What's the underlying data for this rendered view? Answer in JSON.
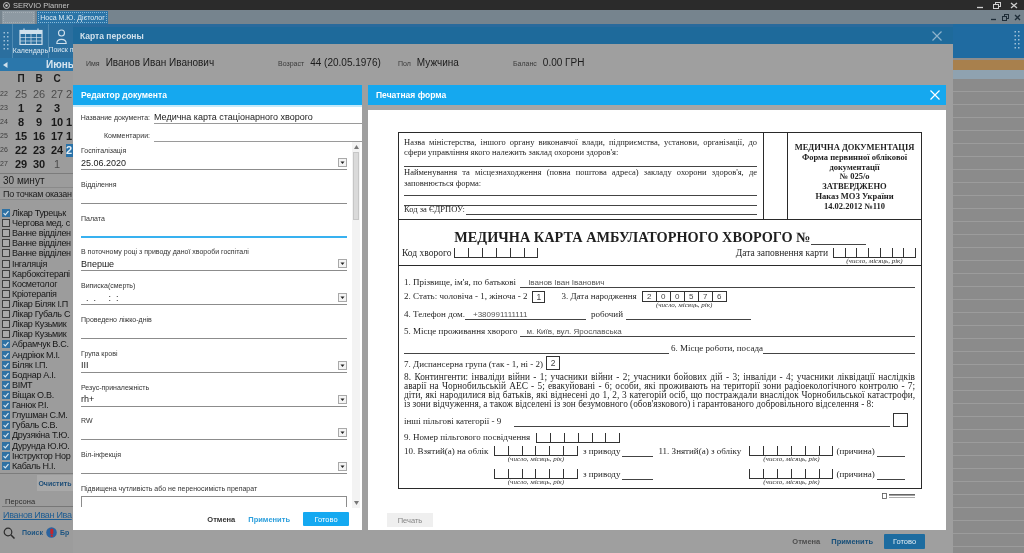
{
  "app": {
    "title": "SERVIO Planner",
    "tabs": [
      {
        "selected": false
      },
      {
        "label": "Носа М.Ю. Дієтолог",
        "selected": true
      }
    ],
    "toolbar": [
      {
        "kind": "calendar",
        "label": "Календарь"
      },
      {
        "kind": "person",
        "label": "Поиск п"
      }
    ]
  },
  "calendar": {
    "month": "Июнь",
    "weekdays": [
      "П",
      "В",
      "С"
    ],
    "weeks": [
      {
        "number": "22",
        "days": [
          {
            "day": "25",
            "other_month": true,
            "selected": false
          },
          {
            "day": "26",
            "other_month": true,
            "selected": false
          },
          {
            "day": "27",
            "other_month": true,
            "selected": false
          },
          {
            "day": "2",
            "other_month": true,
            "selected": false
          }
        ]
      },
      {
        "number": "23",
        "days": [
          {
            "day": "1",
            "other_month": false,
            "selected": false
          },
          {
            "day": "2",
            "other_month": false,
            "selected": false
          },
          {
            "day": "3",
            "other_month": false,
            "selected": false
          }
        ]
      },
      {
        "number": "24",
        "days": [
          {
            "day": "8",
            "other_month": false,
            "selected": false
          },
          {
            "day": "9",
            "other_month": false,
            "selected": false
          },
          {
            "day": "10",
            "other_month": false,
            "selected": false
          },
          {
            "day": "1",
            "other_month": false,
            "selected": false
          }
        ]
      },
      {
        "number": "25",
        "days": [
          {
            "day": "15",
            "other_month": false,
            "selected": false
          },
          {
            "day": "16",
            "other_month": false,
            "selected": false
          },
          {
            "day": "17",
            "other_month": false,
            "selected": false
          },
          {
            "day": "1",
            "other_month": false,
            "selected": false
          }
        ]
      },
      {
        "number": "26",
        "days": [
          {
            "day": "22",
            "other_month": false,
            "selected": false
          },
          {
            "day": "23",
            "other_month": false,
            "selected": false
          },
          {
            "day": "24",
            "other_month": false,
            "selected": false
          },
          {
            "day": "2",
            "other_month": false,
            "selected": true
          }
        ]
      },
      {
        "number": "27",
        "days": [
          {
            "day": "29",
            "other_month": false,
            "selected": false
          },
          {
            "day": "30",
            "other_month": false,
            "selected": false
          },
          {
            "day": "1",
            "other_month": true,
            "selected": false
          }
        ]
      }
    ]
  },
  "interval": "30 минут",
  "filter": "По точкам оказан",
  "resources": [
    {
      "label": "Лікар Турецьк",
      "checked": true
    },
    {
      "label": "Чергова мед. с",
      "checked": false
    },
    {
      "label": "Ванне відділен",
      "checked": false
    },
    {
      "label": "Ванне відділен",
      "checked": false
    },
    {
      "label": "Ванне відділен",
      "checked": false
    },
    {
      "label": "Інгаляція",
      "checked": false
    },
    {
      "label": "Карбоксітерапі",
      "checked": false
    },
    {
      "label": "Косметолог",
      "checked": false
    },
    {
      "label": "Кріотерапія",
      "checked": false
    },
    {
      "label": "Лікар Біляк І.П",
      "checked": false
    },
    {
      "label": "Лікар Губаль С",
      "checked": false
    },
    {
      "label": "Лікар Кузьмик",
      "checked": false
    },
    {
      "label": "Лікар Кузьмик",
      "checked": false
    },
    {
      "label": "Абрамчук В.С.",
      "checked": true
    },
    {
      "label": "Андріюк М.І.",
      "checked": true
    },
    {
      "label": "Біляк І.П.",
      "checked": true
    },
    {
      "label": "Боднар А.І.",
      "checked": true
    },
    {
      "label": "ВІМТ",
      "checked": true
    },
    {
      "label": "Віщак О.В.",
      "checked": true
    },
    {
      "label": "Ганюк Р.І.",
      "checked": true
    },
    {
      "label": "Глушман С.М.",
      "checked": true
    },
    {
      "label": "Губаль С.В.",
      "checked": true
    },
    {
      "label": "Друзякіна Т.Ю.",
      "checked": true
    },
    {
      "label": "Дурунда Ю.Ю.",
      "checked": true
    },
    {
      "label": "Інструктор Нор",
      "checked": true
    },
    {
      "label": "Кабаль Н.І.",
      "checked": true
    }
  ],
  "clear_button": "Очистить",
  "person_section": {
    "label": "Персона",
    "link": "Иванов Иван Ива"
  },
  "bottom_actions": [
    {
      "kind": "search",
      "label": "Поиск"
    },
    {
      "kind": "alert",
      "label": "Бр"
    }
  ],
  "person_card": {
    "title": "Карта персоны",
    "fields": [
      {
        "label": "Имя",
        "value": "Иванов Иван Иванович"
      },
      {
        "label": "Возраст",
        "value": "44 (20.05.1976)"
      },
      {
        "label": "Пол",
        "value": "Мужчина"
      },
      {
        "label": "Баланс",
        "value": "0.00 ГРН"
      }
    ],
    "buttons": [
      {
        "kind": "cancel",
        "label": "Отмена",
        "disabled": true
      },
      {
        "kind": "apply",
        "label": "Применить",
        "disabled": false
      },
      {
        "kind": "done",
        "label": "Готово",
        "disabled": false
      }
    ]
  },
  "editor": {
    "title": "Редактор документа",
    "name_label": "Название документа:",
    "name_value": "Медична карта стаціонарного хворого",
    "comment_label": "Комментарии:",
    "fields": [
      {
        "kind": "dropdown",
        "label": "Госпіталізація",
        "value": "25.06.2020",
        "focused": false
      },
      {
        "kind": "text",
        "label": "Відділення",
        "focused": false
      },
      {
        "kind": "text",
        "label": "Палата",
        "focused": true
      },
      {
        "kind": "dropdown",
        "label": "В поточному році з приводу даної хвороби госпіталі",
        "value": "Вперше",
        "focused": false
      },
      {
        "kind": "dropdown",
        "label": "Виписка(смерть)",
        "value": "  .  .     :  :",
        "focused": false
      },
      {
        "kind": "text",
        "label": "Проведено ліжко-днів",
        "focused": false
      },
      {
        "kind": "dropdown",
        "label": "Група крові",
        "value": "III",
        "focused": false
      },
      {
        "kind": "dropdown",
        "label": "Резус-приналежність",
        "value": "rh+",
        "focused": false
      },
      {
        "kind": "dropdown",
        "label": "RW",
        "focused": false
      },
      {
        "kind": "dropdown",
        "label": "Віл-інфекція",
        "focused": false
      },
      {
        "kind": "textarea",
        "label": "Підвищена чутливість або не переносимість препарат",
        "focused": false
      }
    ],
    "buttons": [
      {
        "kind": "cancel",
        "label": "Отмена"
      },
      {
        "kind": "apply",
        "label": "Применить"
      },
      {
        "kind": "done",
        "label": "Готово"
      }
    ]
  },
  "print_form": {
    "title": "Печатная форма",
    "print_button": {
      "label": "Печать",
      "disabled": true
    },
    "document": {
      "ministry_text": "Назва міністерства, іншого органу виконавчої влади, підприємства, установи, організації, до сфери управління якого належить заклад охорони здоров'я:",
      "institution_text": "Найменування та місцезнаходження (повна поштова адреса) закладу охорони здоров'я, де заповнюється форма:",
      "edrpou_label": "Код за ЄДРПОУ:",
      "stamp": [
        "МЕДИЧНА ДОКУМЕНТАЦІЯ",
        "Форма первинної облікової",
        "документації",
        "№ 025/о",
        "ЗАТВЕРДЖЕНО",
        "Наказ МОЗ України",
        "14.02.2012 №110"
      ],
      "title": "МЕДИЧНА КАРТА АМБУЛАТОРНОГО ХВОРОГО №",
      "patient_code_label": "Код хворого",
      "fill_date": {
        "label": "Дата заповнення карти",
        "hint": "(число, місяць, рік)"
      },
      "full_name": {
        "label": "1. Прізвище, ім'я, по батькові",
        "value": "Іванов Іван Іванович"
      },
      "sex": {
        "label": "2. Стать: чоловіча - 1, жіноча - 2",
        "value": "1"
      },
      "birth_date": {
        "label": "3. Дата народження",
        "digits": [
          "2",
          "0",
          "0",
          "5",
          "7",
          "6"
        ],
        "hint": "(число, місяць, рік)"
      },
      "phone": {
        "label": "4. Телефон дом.",
        "value": "+380991111111",
        "work_label": "робочий"
      },
      "address": {
        "label": "5. Місце проживання хворого",
        "value": "м. Київ, вул. Ярославська"
      },
      "workplace_label": "6. Місце роботи, посада",
      "dispensary": {
        "label": "7. Диспансерна група (так - 1, ні - 2)",
        "value": "2"
      },
      "contingents": "8. Контингенти: інваліди війни - 1; учасники війни - 2; учасники бойових дій - 3; інваліди - 4; учасники ліквідації наслідків аварії на Чорнобильській АЕС - 5; евакуйовані - 6; особи, які проживають на території зони радіоекологічного контролю - 7; діти, які народилися від батьків, які віднесені до 1, 2, 3 категорій осіб, що постраждали внаслідок Чорнобильської катастрофи, із зони відчуження, а також відселені із зон безумовного (обов'язкового) і гарантованого добровільного відселення - 8:",
      "other_categories_label": "інші пільгові категорії - 9",
      "certificate_label": "9. Номер пільгового посвідчення",
      "registration": [
        {
          "taken_label": "10. Взятий(а) на облік",
          "taken_hint": "(число, місяць, рік)",
          "reason_label": "з приводу",
          "removed_label": "11. Знятий(а) з обліку",
          "removed_hint": "(число, місяць, рік)",
          "cause_label": "(причина)"
        },
        {
          "taken_hint": "(число, місяць, рік)",
          "reason_label": "з приводу",
          "removed_hint": "(число, місяць, рік)",
          "cause_label": "(причина)"
        }
      ]
    }
  }
}
